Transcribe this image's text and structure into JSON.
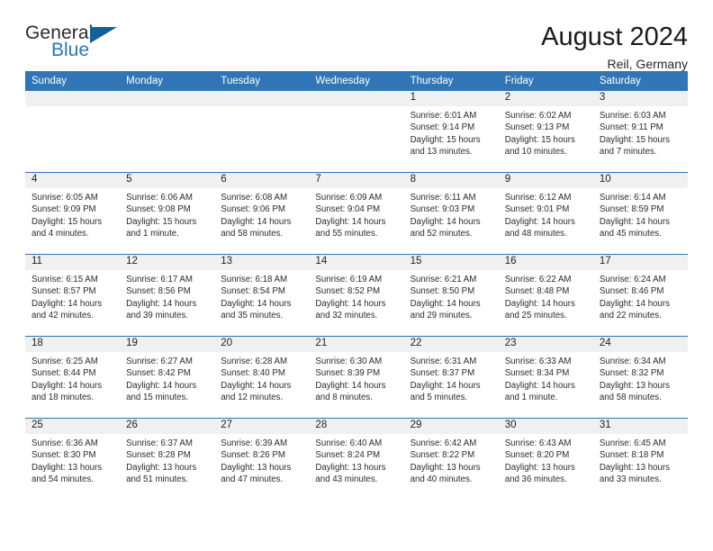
{
  "brand": {
    "name_top": "General",
    "name_bottom": "Blue",
    "triangle_icon": "triangle-icon",
    "color_dark": "#2b2b2b",
    "color_blue": "#2476c4"
  },
  "header": {
    "title": "August 2024",
    "subtitle": "Reil, Germany"
  },
  "theme": {
    "header_blue": "#3075b5",
    "daynum_band": "#f0f0f0",
    "text": "#2b2b2b"
  },
  "calendar": {
    "weekday_headers": [
      "Sunday",
      "Monday",
      "Tuesday",
      "Wednesday",
      "Thursday",
      "Friday",
      "Saturday"
    ],
    "weeks": [
      [
        {
          "day": "",
          "lines": []
        },
        {
          "day": "",
          "lines": []
        },
        {
          "day": "",
          "lines": []
        },
        {
          "day": "",
          "lines": []
        },
        {
          "day": "1",
          "lines": [
            "Sunrise: 6:01 AM",
            "Sunset: 9:14 PM",
            "Daylight: 15 hours",
            "and 13 minutes."
          ]
        },
        {
          "day": "2",
          "lines": [
            "Sunrise: 6:02 AM",
            "Sunset: 9:13 PM",
            "Daylight: 15 hours",
            "and 10 minutes."
          ]
        },
        {
          "day": "3",
          "lines": [
            "Sunrise: 6:03 AM",
            "Sunset: 9:11 PM",
            "Daylight: 15 hours",
            "and 7 minutes."
          ]
        }
      ],
      [
        {
          "day": "4",
          "lines": [
            "Sunrise: 6:05 AM",
            "Sunset: 9:09 PM",
            "Daylight: 15 hours",
            "and 4 minutes."
          ]
        },
        {
          "day": "5",
          "lines": [
            "Sunrise: 6:06 AM",
            "Sunset: 9:08 PM",
            "Daylight: 15 hours",
            "and 1 minute."
          ]
        },
        {
          "day": "6",
          "lines": [
            "Sunrise: 6:08 AM",
            "Sunset: 9:06 PM",
            "Daylight: 14 hours",
            "and 58 minutes."
          ]
        },
        {
          "day": "7",
          "lines": [
            "Sunrise: 6:09 AM",
            "Sunset: 9:04 PM",
            "Daylight: 14 hours",
            "and 55 minutes."
          ]
        },
        {
          "day": "8",
          "lines": [
            "Sunrise: 6:11 AM",
            "Sunset: 9:03 PM",
            "Daylight: 14 hours",
            "and 52 minutes."
          ]
        },
        {
          "day": "9",
          "lines": [
            "Sunrise: 6:12 AM",
            "Sunset: 9:01 PM",
            "Daylight: 14 hours",
            "and 48 minutes."
          ]
        },
        {
          "day": "10",
          "lines": [
            "Sunrise: 6:14 AM",
            "Sunset: 8:59 PM",
            "Daylight: 14 hours",
            "and 45 minutes."
          ]
        }
      ],
      [
        {
          "day": "11",
          "lines": [
            "Sunrise: 6:15 AM",
            "Sunset: 8:57 PM",
            "Daylight: 14 hours",
            "and 42 minutes."
          ]
        },
        {
          "day": "12",
          "lines": [
            "Sunrise: 6:17 AM",
            "Sunset: 8:56 PM",
            "Daylight: 14 hours",
            "and 39 minutes."
          ]
        },
        {
          "day": "13",
          "lines": [
            "Sunrise: 6:18 AM",
            "Sunset: 8:54 PM",
            "Daylight: 14 hours",
            "and 35 minutes."
          ]
        },
        {
          "day": "14",
          "lines": [
            "Sunrise: 6:19 AM",
            "Sunset: 8:52 PM",
            "Daylight: 14 hours",
            "and 32 minutes."
          ]
        },
        {
          "day": "15",
          "lines": [
            "Sunrise: 6:21 AM",
            "Sunset: 8:50 PM",
            "Daylight: 14 hours",
            "and 29 minutes."
          ]
        },
        {
          "day": "16",
          "lines": [
            "Sunrise: 6:22 AM",
            "Sunset: 8:48 PM",
            "Daylight: 14 hours",
            "and 25 minutes."
          ]
        },
        {
          "day": "17",
          "lines": [
            "Sunrise: 6:24 AM",
            "Sunset: 8:46 PM",
            "Daylight: 14 hours",
            "and 22 minutes."
          ]
        }
      ],
      [
        {
          "day": "18",
          "lines": [
            "Sunrise: 6:25 AM",
            "Sunset: 8:44 PM",
            "Daylight: 14 hours",
            "and 18 minutes."
          ]
        },
        {
          "day": "19",
          "lines": [
            "Sunrise: 6:27 AM",
            "Sunset: 8:42 PM",
            "Daylight: 14 hours",
            "and 15 minutes."
          ]
        },
        {
          "day": "20",
          "lines": [
            "Sunrise: 6:28 AM",
            "Sunset: 8:40 PM",
            "Daylight: 14 hours",
            "and 12 minutes."
          ]
        },
        {
          "day": "21",
          "lines": [
            "Sunrise: 6:30 AM",
            "Sunset: 8:39 PM",
            "Daylight: 14 hours",
            "and 8 minutes."
          ]
        },
        {
          "day": "22",
          "lines": [
            "Sunrise: 6:31 AM",
            "Sunset: 8:37 PM",
            "Daylight: 14 hours",
            "and 5 minutes."
          ]
        },
        {
          "day": "23",
          "lines": [
            "Sunrise: 6:33 AM",
            "Sunset: 8:34 PM",
            "Daylight: 14 hours",
            "and 1 minute."
          ]
        },
        {
          "day": "24",
          "lines": [
            "Sunrise: 6:34 AM",
            "Sunset: 8:32 PM",
            "Daylight: 13 hours",
            "and 58 minutes."
          ]
        }
      ],
      [
        {
          "day": "25",
          "lines": [
            "Sunrise: 6:36 AM",
            "Sunset: 8:30 PM",
            "Daylight: 13 hours",
            "and 54 minutes."
          ]
        },
        {
          "day": "26",
          "lines": [
            "Sunrise: 6:37 AM",
            "Sunset: 8:28 PM",
            "Daylight: 13 hours",
            "and 51 minutes."
          ]
        },
        {
          "day": "27",
          "lines": [
            "Sunrise: 6:39 AM",
            "Sunset: 8:26 PM",
            "Daylight: 13 hours",
            "and 47 minutes."
          ]
        },
        {
          "day": "28",
          "lines": [
            "Sunrise: 6:40 AM",
            "Sunset: 8:24 PM",
            "Daylight: 13 hours",
            "and 43 minutes."
          ]
        },
        {
          "day": "29",
          "lines": [
            "Sunrise: 6:42 AM",
            "Sunset: 8:22 PM",
            "Daylight: 13 hours",
            "and 40 minutes."
          ]
        },
        {
          "day": "30",
          "lines": [
            "Sunrise: 6:43 AM",
            "Sunset: 8:20 PM",
            "Daylight: 13 hours",
            "and 36 minutes."
          ]
        },
        {
          "day": "31",
          "lines": [
            "Sunrise: 6:45 AM",
            "Sunset: 8:18 PM",
            "Daylight: 13 hours",
            "and 33 minutes."
          ]
        }
      ]
    ]
  }
}
